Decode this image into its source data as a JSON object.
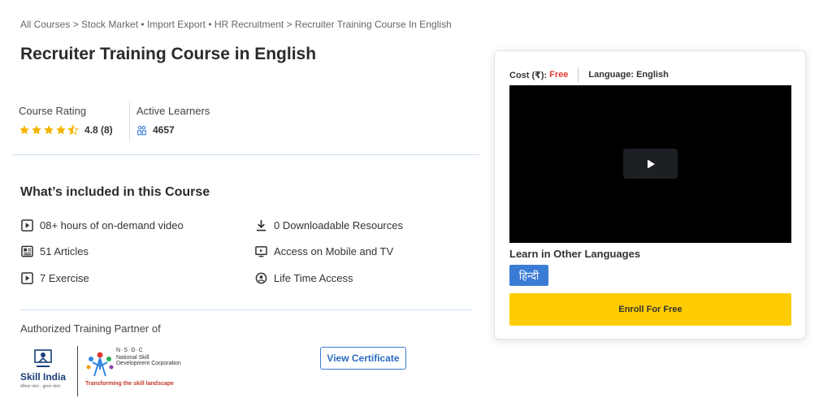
{
  "breadcrumb": {
    "items": [
      "All Courses",
      "Stock Market",
      "Import Export",
      "HR Recruitment",
      "Recruiter Training Course In English"
    ],
    "separators": [
      " > ",
      " • ",
      " • ",
      " > "
    ]
  },
  "page_title": "Recruiter Training Course in English",
  "stats": {
    "rating_label": "Course Rating",
    "rating_value": "4.8 (8)",
    "stars": 4.5,
    "learners_label": "Active Learners",
    "learners_value": "4657"
  },
  "included": {
    "title": "What’s included in this Course",
    "features": [
      {
        "icon": "video-play-icon",
        "label": "08+ hours of on-demand video"
      },
      {
        "icon": "article-icon",
        "label": "51 Articles"
      },
      {
        "icon": "exercise-play-icon",
        "label": "7 Exercise"
      },
      {
        "icon": "download-icon",
        "label": "0 Downloadable Resources"
      },
      {
        "icon": "tv-icon",
        "label": "Access on Mobile and TV"
      },
      {
        "icon": "lifetime-icon",
        "label": "Life Time Access"
      }
    ]
  },
  "partner": {
    "label": "Authorized Training Partner of",
    "skill_india": "Skill India",
    "skill_india_sub": "कौशल भारत - कुशल भारत",
    "nsdc_title": "N·S·D·C",
    "nsdc_name": "National Skill Development Corporation",
    "nsdc_tagline": "Transforming the skill landscape",
    "view_certificate": "View Certificate"
  },
  "card": {
    "cost_label": "Cost (₹):",
    "cost_value": "Free",
    "language_label": "Language: English",
    "other_languages_label": "Learn in Other Languages",
    "hindi_label": "हिन्दी",
    "enroll_label": "Enroll For Free"
  },
  "colors": {
    "accent_blue": "#3a7bd5",
    "enroll_yellow": "#ffcc00",
    "free_red": "#e53935",
    "star_yellow": "#f5b400"
  }
}
